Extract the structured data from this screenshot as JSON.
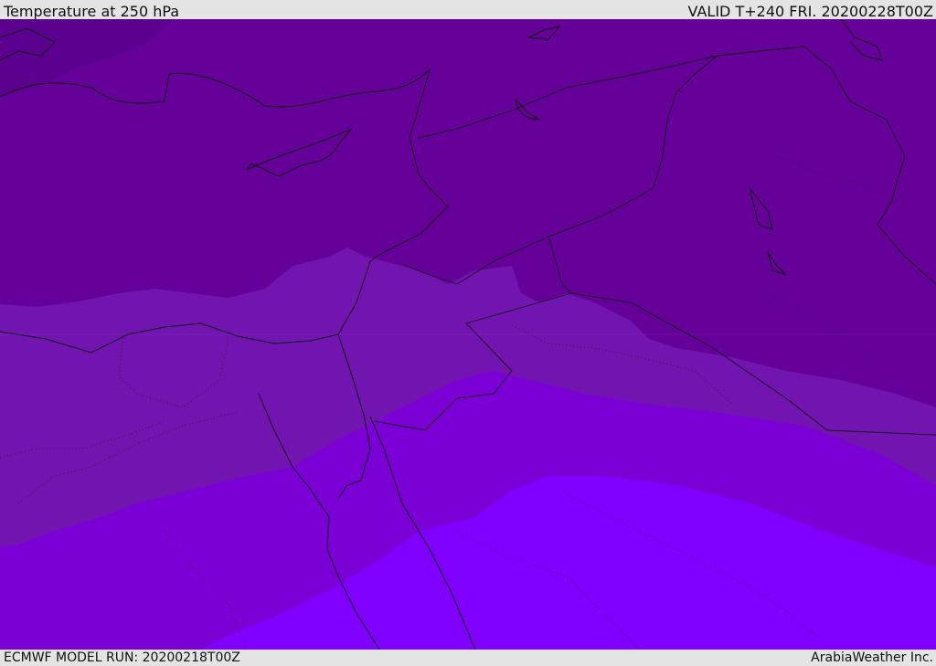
{
  "header": {
    "title": "Temperature at 250 hPa",
    "valid": "VALID T+240 FRI. 20200228T00Z"
  },
  "footer": {
    "model_run": "ECMWF MODEL RUN: 20200218T00Z",
    "credit": "ArabiaWeather Inc."
  },
  "colors": {
    "bar_bg": "#e4e4e4",
    "band_coldest": "#5c0090",
    "band_cold": "#650099",
    "band_mid": "#7214b0",
    "band_warm": "#7a00d6",
    "band_warmest": "#7f00ff",
    "coastline": "#111111"
  },
  "map": {
    "variable": "Temperature",
    "level": "250 hPa",
    "icon": "weather-map"
  }
}
